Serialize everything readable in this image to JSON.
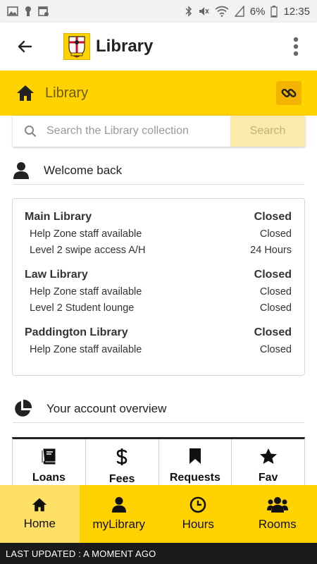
{
  "status_bar": {
    "battery": "6%",
    "time": "12:35",
    "icons": [
      "image-icon",
      "keyhole-icon",
      "calendar-icon",
      "bluetooth-icon",
      "mute-icon",
      "wifi-icon",
      "signal-icon",
      "battery-icon"
    ]
  },
  "app_bar": {
    "title": "Library",
    "icons": [
      "back-arrow-icon",
      "crest-logo",
      "overflow-menu-icon"
    ]
  },
  "library_header": {
    "title": "Library",
    "icons": [
      "home-icon",
      "link-icon"
    ]
  },
  "search": {
    "placeholder": "Search the Library collection",
    "value": "",
    "button_label": "Search",
    "icon": "search-icon"
  },
  "welcome": {
    "label": "Welcome back",
    "icon": "user-icon"
  },
  "hours": [
    {
      "name": "Main Library",
      "status": "Closed",
      "services": [
        {
          "name": "Help Zone staff available",
          "status": "Closed"
        },
        {
          "name": "Level 2 swipe access A/H",
          "status": "24 Hours"
        }
      ]
    },
    {
      "name": "Law Library",
      "status": "Closed",
      "services": [
        {
          "name": "Help Zone staff available",
          "status": "Closed"
        },
        {
          "name": "Level 2 Student lounge",
          "status": "Closed"
        }
      ]
    },
    {
      "name": "Paddington Library",
      "status": "Closed",
      "services": [
        {
          "name": "Help Zone staff available",
          "status": "Closed"
        }
      ]
    }
  ],
  "account": {
    "label": "Your account overview",
    "icon": "pie-chart-icon",
    "tiles": [
      {
        "label": "Loans",
        "icon": "book-icon"
      },
      {
        "label": "Fees",
        "icon": "dollar-icon"
      },
      {
        "label": "Requests",
        "icon": "bookmark-icon"
      },
      {
        "label": "Fav",
        "icon": "star-icon"
      }
    ]
  },
  "bottom_nav": [
    {
      "label": "Home",
      "icon": "home-icon",
      "active": true
    },
    {
      "label": "myLibrary",
      "icon": "user-icon",
      "active": false
    },
    {
      "label": "Hours",
      "icon": "clock-icon",
      "active": false
    },
    {
      "label": "Rooms",
      "icon": "group-icon",
      "active": false
    }
  ],
  "last_updated": "LAST UPDATED : A MOMENT AGO",
  "colors": {
    "brand_yellow": "#ffd200",
    "active_nav": "#ffe066",
    "link_button": "#f2b400",
    "search_button": "#fbeaa9",
    "footer_bar": "#1a1a1a"
  }
}
